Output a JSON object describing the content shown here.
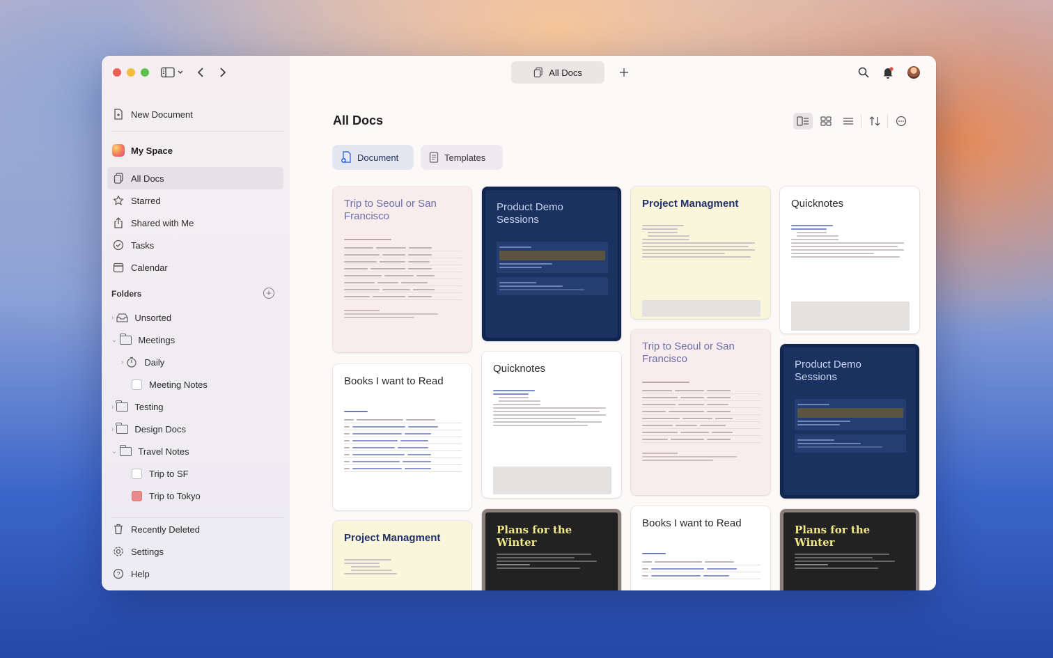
{
  "window": {
    "tab_title": "All Docs"
  },
  "sidebar": {
    "new_document": "New Document",
    "space_name": "My Space",
    "nav": [
      {
        "label": "All Docs",
        "icon": "docs-icon"
      },
      {
        "label": "Starred",
        "icon": "star-icon"
      },
      {
        "label": "Shared with Me",
        "icon": "share-icon"
      },
      {
        "label": "Tasks",
        "icon": "check-circle-icon"
      },
      {
        "label": "Calendar",
        "icon": "calendar-icon"
      }
    ],
    "folders_header": "Folders",
    "folders": [
      {
        "label": "Unsorted"
      },
      {
        "label": "Meetings"
      },
      {
        "label": "Daily"
      },
      {
        "label": "Meeting Notes"
      },
      {
        "label": "Testing"
      },
      {
        "label": "Design Docs"
      },
      {
        "label": "Travel Notes"
      },
      {
        "label": "Trip to SF"
      },
      {
        "label": "Trip to Tokyo"
      }
    ],
    "footer": [
      {
        "label": "Recently Deleted"
      },
      {
        "label": "Settings"
      },
      {
        "label": "Help"
      }
    ]
  },
  "main": {
    "title": "All Docs",
    "segments": [
      {
        "label": "Document"
      },
      {
        "label": "Templates"
      }
    ],
    "cards": [
      {
        "title": "Trip to Seoul or San Francisco",
        "style": "pink"
      },
      {
        "title": "Product Demo Sessions",
        "style": "blue"
      },
      {
        "title": "Project Managment",
        "style": "yellow"
      },
      {
        "title": "Quicknotes",
        "style": "white"
      },
      {
        "title": "Books I want to Read",
        "style": "white"
      },
      {
        "title": "Quicknotes",
        "style": "white"
      },
      {
        "title": "Trip to Seoul or San Francisco",
        "style": "pink"
      },
      {
        "title": "Product Demo Sessions",
        "style": "blue"
      },
      {
        "title": "Project Managment",
        "style": "yellow"
      },
      {
        "title": "Plans for the Winter",
        "style": "dark"
      },
      {
        "title": "Books I want to Read",
        "style": "white"
      },
      {
        "title": "Plans for the Winter",
        "style": "dark"
      }
    ]
  }
}
